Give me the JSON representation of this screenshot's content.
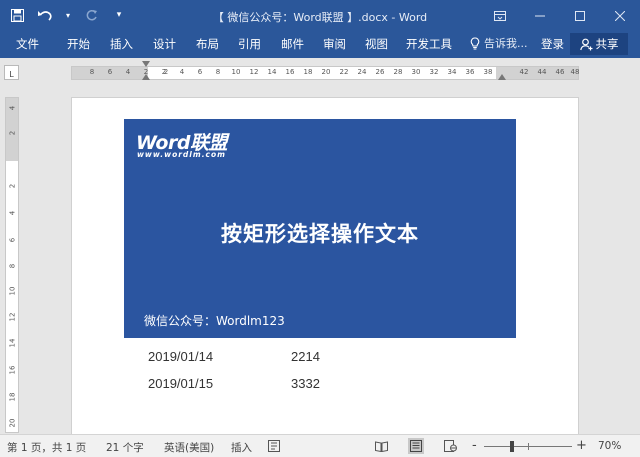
{
  "window": {
    "title": "【 微信公众号：Word联盟 】.docx  -  Word"
  },
  "ribbon": {
    "tabs": [
      "文件",
      "开始",
      "插入",
      "设计",
      "布局",
      "引用",
      "邮件",
      "审阅",
      "视图",
      "开发工具"
    ],
    "tell_me": "告诉我...",
    "login": "登录",
    "share": "共享"
  },
  "ruler": {
    "corner": "L",
    "h_numbers": [
      "8",
      "6",
      "4",
      "2",
      "2",
      "2",
      "4",
      "6",
      "8",
      "10",
      "12",
      "14",
      "16",
      "18",
      "20",
      "22",
      "24",
      "26",
      "28",
      "30",
      "32",
      "34",
      "36",
      "38",
      "42",
      "44",
      "46",
      "48"
    ],
    "v_numbers": [
      "4",
      "2",
      "2",
      "4",
      "6",
      "8",
      "10",
      "12",
      "14",
      "16",
      "18",
      "20"
    ]
  },
  "document": {
    "banner": {
      "logo": "Word联盟",
      "logo_url": "www.wordlm.com",
      "headline": "按矩形选择操作文本",
      "wechat": "微信公众号：Wordlm123",
      "color": "#2b55a0"
    },
    "rows": [
      {
        "date": "2019/01/14",
        "value": "2214"
      },
      {
        "date": "2019/01/15",
        "value": "3332"
      }
    ]
  },
  "status": {
    "page": "第 1 页，共 1 页",
    "words": "21 个字",
    "language": "英语(美国)",
    "insert": "插入",
    "zoom": "70%",
    "zoom_minus": "-",
    "zoom_plus": "+"
  },
  "colors": {
    "accent": "#2b579a"
  }
}
